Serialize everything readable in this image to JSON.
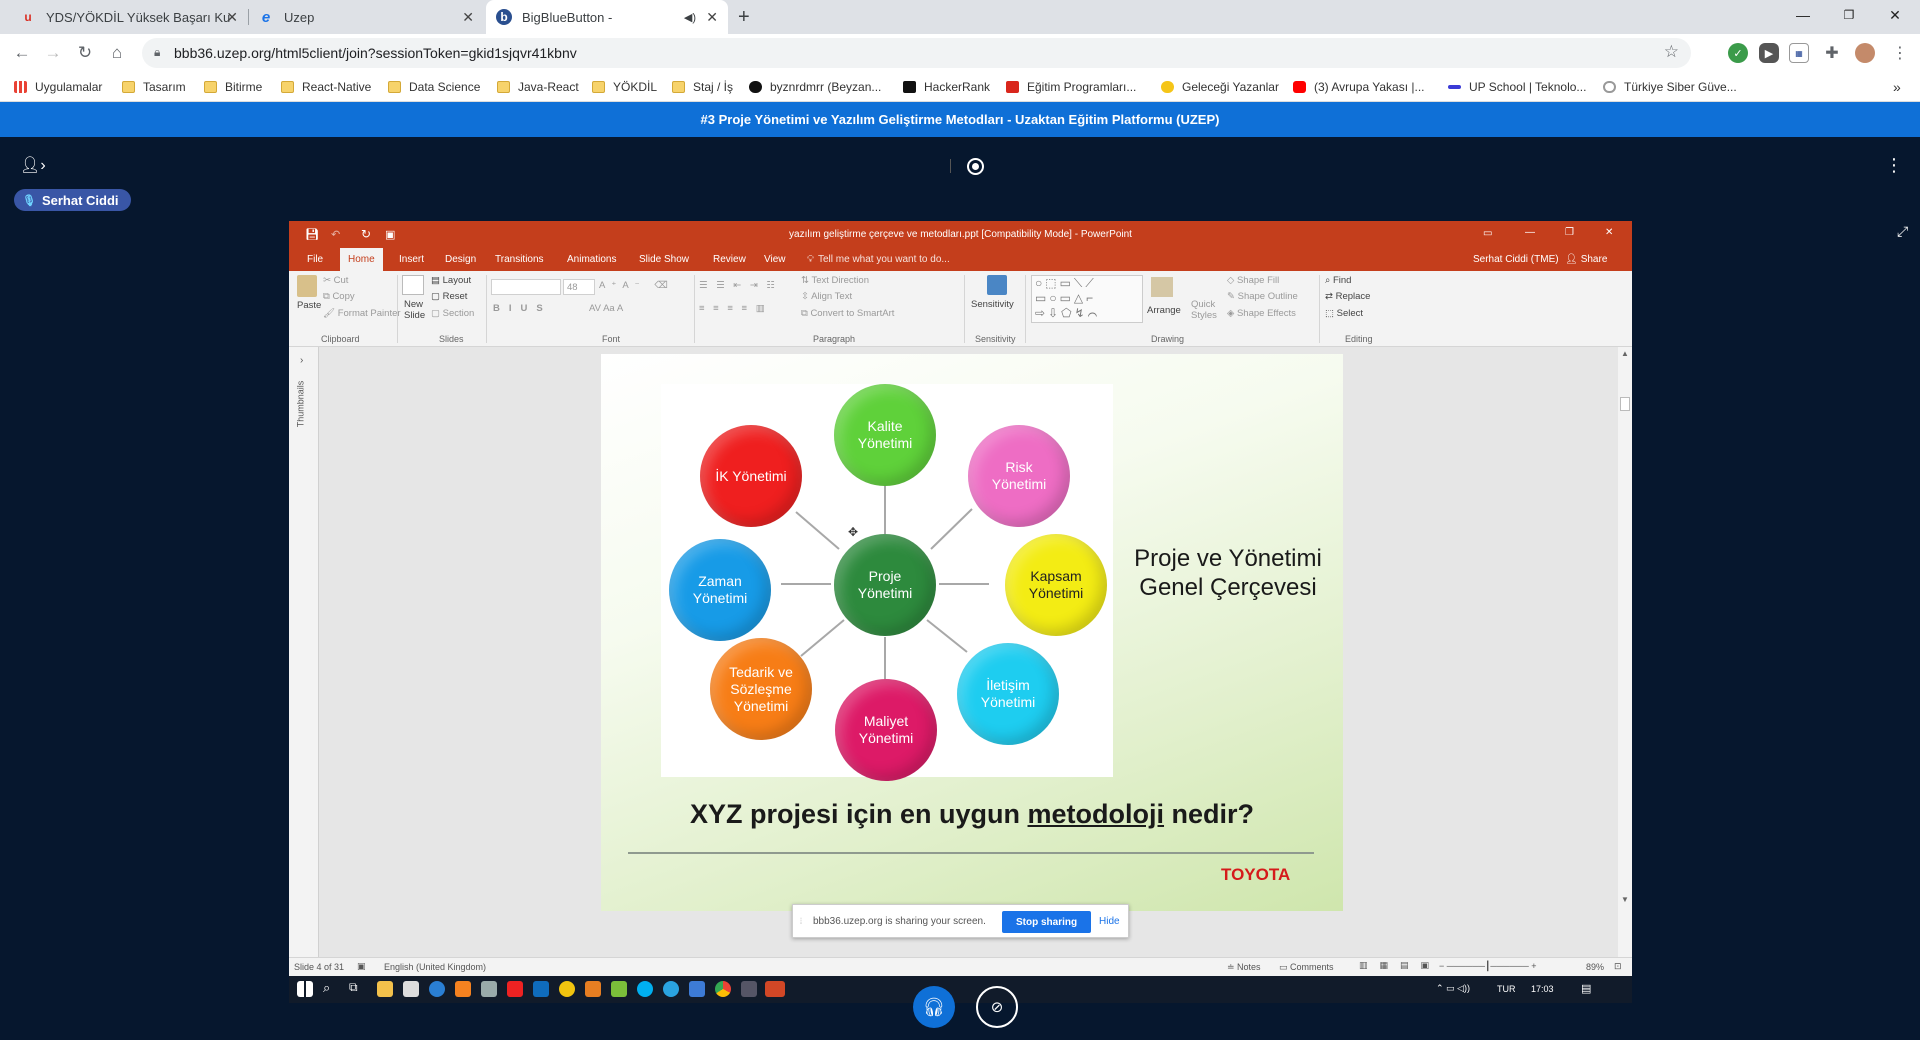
{
  "tabs": [
    {
      "title": "YDS/YÖKDİL Yüksek Başarı Kursu",
      "favicon": "u",
      "color": "#d93025"
    },
    {
      "title": "Uzep",
      "favicon": "e",
      "color": "#1a73e8"
    },
    {
      "title": "BigBlueButton -",
      "favicon": "b",
      "color": "#2a4f8f"
    }
  ],
  "new_tab_symbol": "+",
  "address": {
    "url": "bbb36.uzep.org/html5client/join?sessionToken=gkid1sjqvr41kbnv"
  },
  "bookmarks": [
    {
      "label": "Uygulamalar",
      "icon": "apps-grid"
    },
    {
      "label": "Tasarım",
      "icon": "folder"
    },
    {
      "label": "Bitirme",
      "icon": "folder"
    },
    {
      "label": "React-Native",
      "icon": "folder"
    },
    {
      "label": "Data Science",
      "icon": "folder"
    },
    {
      "label": "Java-React",
      "icon": "folder"
    },
    {
      "label": "YÖKDİL",
      "icon": "folder"
    },
    {
      "label": "Staj / İş",
      "icon": "folder"
    },
    {
      "label": "byznrdmrr (Beyzan...",
      "icon": "github"
    },
    {
      "label": "HackerRank",
      "icon": "hackerrank"
    },
    {
      "label": "Eğitim Programları...",
      "icon": "red-a"
    },
    {
      "label": "Geleceği Yazanlar",
      "icon": "gy"
    },
    {
      "label": "(3) Avrupa Yakası |...",
      "icon": "youtube"
    },
    {
      "label": "UP School | Teknolo...",
      "icon": "upschool"
    },
    {
      "label": "Türkiye Siber Güve...",
      "icon": "tsg"
    }
  ],
  "bookmarks_more": "»",
  "bbb": {
    "title": "#3 Proje Yönetimi ve Yazılım Geliştirme Metodları - Uzaktan Eğitim Platformu (UZEP)",
    "presenter": "Serhat Ciddi"
  },
  "ppt": {
    "window_title": "yazılım geliştirme çerçeve ve metodları.ppt [Compatibility Mode] - PowerPoint",
    "tabs": [
      "File",
      "Home",
      "Insert",
      "Design",
      "Transitions",
      "Animations",
      "Slide Show",
      "Review",
      "View"
    ],
    "tell_me": "Tell me what you want to do...",
    "user": "Serhat Ciddi (TME)",
    "share": "Share",
    "ribbon": {
      "paste": "Paste",
      "cut": "Cut",
      "copy": "Copy",
      "format_painter": "Format Painter",
      "new_slide_1": "New",
      "new_slide_2": "Slide",
      "layout": "Layout",
      "reset": "Reset",
      "section": "Section",
      "font_size": "48",
      "text_direction": "Text Direction",
      "align_text": "Align Text",
      "convert_smartart": "Convert to SmartArt",
      "sensitivity": "Sensitivity",
      "arrange": "Arrange",
      "quick_styles_1": "Quick",
      "quick_styles_2": "Styles",
      "shape_fill": "Shape Fill",
      "shape_outline": "Shape Outline",
      "shape_effects": "Shape Effects",
      "find": "Find",
      "replace": "Replace",
      "select": "Select",
      "groups": {
        "clipboard": "Clipboard",
        "slides": "Slides",
        "font": "Font",
        "paragraph": "Paragraph",
        "sensitivity": "Sensitivity",
        "drawing": "Drawing",
        "editing": "Editing"
      }
    },
    "thumbnails_label": "Thumbnails",
    "status": {
      "slide": "Slide 4 of 31",
      "language": "English (United Kingdom)",
      "notes": "Notes",
      "comments": "Comments",
      "zoom": "89%"
    }
  },
  "slide": {
    "center": "Proje Yönetimi",
    "bubbles": [
      {
        "label": "Kalite Yönetimi",
        "color": "#5fd13a"
      },
      {
        "label": "Risk Yönetimi",
        "color": "#ee6dc4"
      },
      {
        "label": "Kapsam Yönetimi",
        "color": "#f3ec14"
      },
      {
        "label": "İletişim Yönetimi",
        "color": "#1ecdf0"
      },
      {
        "label": "Maliyet Yönetimi",
        "color": "#dd1a67"
      },
      {
        "label": "Tedarik ve Sözleşme Yönetimi",
        "color": "#f77d16"
      },
      {
        "label": "Zaman Yönetimi",
        "color": "#179be7"
      },
      {
        "label": "İK Yönetimi",
        "color": "#ef1f1f"
      }
    ],
    "center_color": "#2d8a3d",
    "heading_line1": "Proje ve Yönetimi",
    "heading_line2": "Genel Çerçevesi",
    "question_part1": "XYZ projesi için en uygun ",
    "question_underlined": "metodoloji",
    "question_part2": " nedir?",
    "logo": "TOYOTA"
  },
  "share_notice": {
    "text": "bbb36.uzep.org is sharing your screen.",
    "stop": "Stop sharing",
    "hide": "Hide"
  },
  "taskbar": {
    "lang": "TUR",
    "time": "17:03"
  }
}
